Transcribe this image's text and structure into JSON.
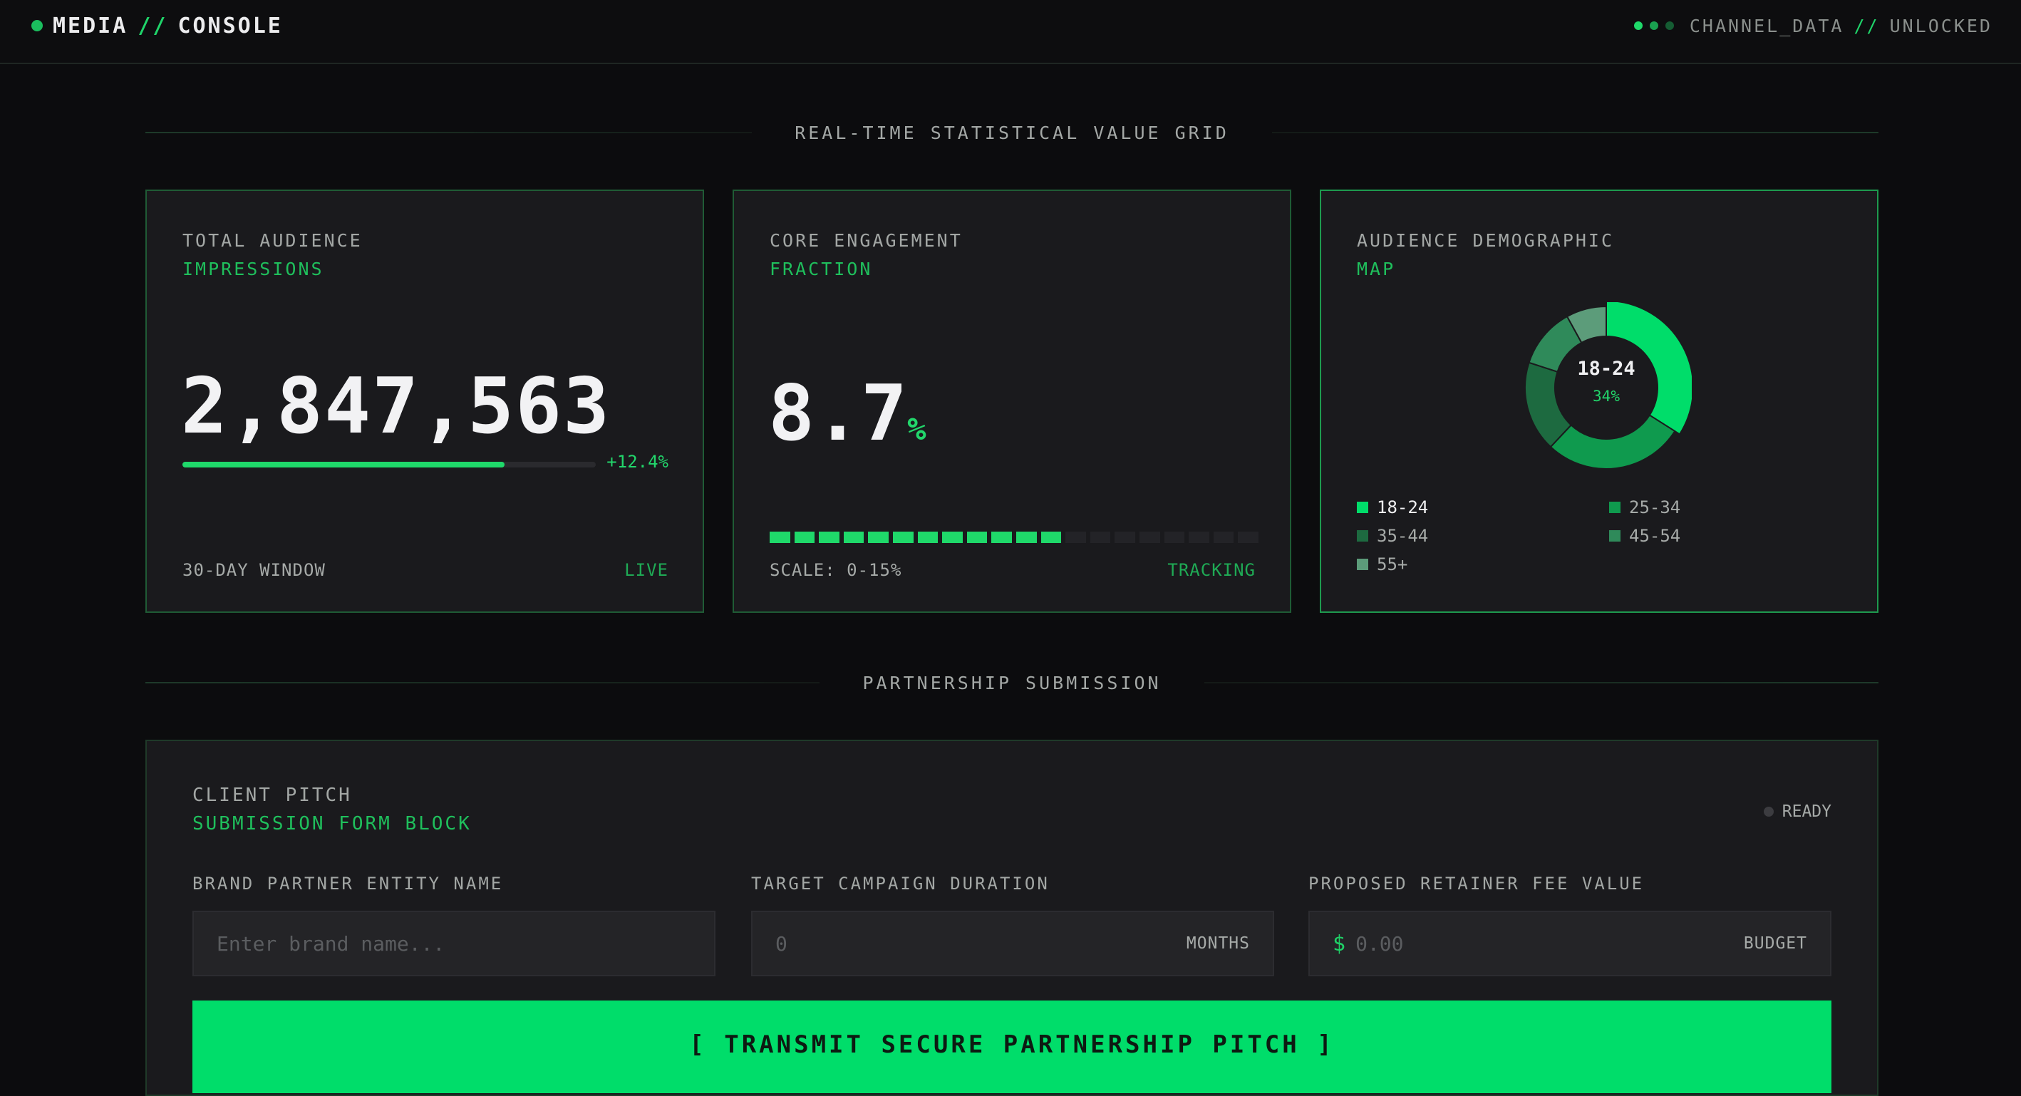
{
  "header": {
    "brand_left": "MEDIA",
    "brand_sep": "//",
    "brand_right": "CONSOLE",
    "status_left": "CHANNEL_DATA",
    "status_sep": "//",
    "status_right": "UNLOCKED",
    "status_dot_colors": [
      "#1fd96a",
      "#1aa050",
      "#155c33"
    ]
  },
  "sections": {
    "stats_title": "REAL-TIME STATISTICAL VALUE GRID",
    "form_title": "PARTNERSHIP SUBMISSION"
  },
  "cards": {
    "audience": {
      "label": "TOTAL AUDIENCE",
      "sub": "IMPRESSIONS",
      "value": "2,847,563",
      "progress_fraction": 0.78,
      "delta": "+12.4%",
      "foot_left": "30-DAY WINDOW",
      "foot_right": "LIVE"
    },
    "engagement": {
      "label": "CORE ENGAGEMENT",
      "sub": "FRACTION",
      "value": "8.7",
      "unit": "%",
      "segments_total": 20,
      "segments_on": 12,
      "foot_left": "SCALE: 0-15%",
      "foot_right": "TRACKING"
    },
    "demographic": {
      "label": "AUDIENCE DEMOGRAPHIC",
      "sub": "MAP",
      "center_label": "18-24",
      "center_value": "34%",
      "legend": [
        {
          "label": "18-24",
          "color": "#00dd6a",
          "active": true
        },
        {
          "label": "25-34",
          "color": "#0f9a4e",
          "active": false
        },
        {
          "label": "35-44",
          "color": "#1d6a40",
          "active": false
        },
        {
          "label": "45-54",
          "color": "#2f8a5a",
          "active": false
        },
        {
          "label": "55+",
          "color": "#5c9c7a",
          "active": false
        }
      ]
    }
  },
  "chart_data": {
    "type": "pie",
    "categories": [
      "18-24",
      "25-34",
      "35-44",
      "45-54",
      "55+"
    ],
    "values": [
      34,
      28,
      18,
      12,
      8
    ],
    "colors": [
      "#00dd6a",
      "#0f9a4e",
      "#1d6a40",
      "#2f8a5a",
      "#5c9c7a"
    ]
  },
  "form": {
    "head": "CLIENT PITCH",
    "sub": "SUBMISSION FORM BLOCK",
    "status": "READY",
    "brand_label": "BRAND PARTNER ENTITY NAME",
    "brand_placeholder": "Enter brand name...",
    "duration_label": "TARGET CAMPAIGN DURATION",
    "duration_placeholder": "0",
    "duration_suffix": "MONTHS",
    "fee_label": "PROPOSED RETAINER FEE VALUE",
    "fee_prefix": "$",
    "fee_placeholder": "0.00",
    "fee_suffix": "BUDGET",
    "submit_label": "[ TRANSMIT SECURE PARTNERSHIP PITCH ]"
  }
}
